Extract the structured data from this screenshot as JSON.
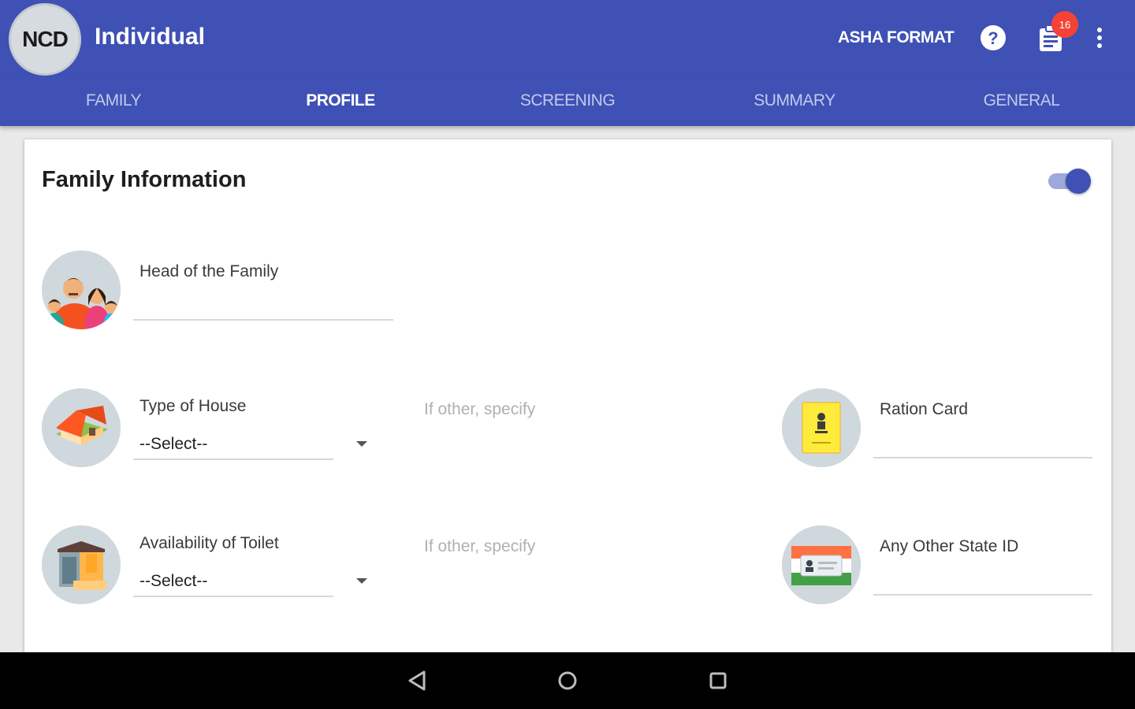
{
  "appbar": {
    "logo_text": "NCD",
    "title": "Individual",
    "action_label": "ASHA FORMAT",
    "notification_count": "16",
    "color": "#3f51b5"
  },
  "tabs": [
    {
      "label": "FAMILY",
      "active": false
    },
    {
      "label": "PROFILE",
      "active": true
    },
    {
      "label": "SCREENING",
      "active": false
    },
    {
      "label": "SUMMARY",
      "active": false
    },
    {
      "label": "GENERAL",
      "active": false
    }
  ],
  "card": {
    "title": "Family Information",
    "toggle_on": true
  },
  "form": {
    "head_of_family": {
      "label": "Head of the Family",
      "value": "",
      "icon": "family-icon"
    },
    "type_of_house": {
      "label": "Type of House",
      "value": "--Select--",
      "icon": "house-icon"
    },
    "house_other": {
      "placeholder": "If other, specify",
      "value": ""
    },
    "ration_card": {
      "label": "Ration Card",
      "value": "",
      "icon": "ration-card-icon"
    },
    "toilet": {
      "label": "Availability of Toilet",
      "value": "--Select--",
      "icon": "toilet-icon"
    },
    "toilet_other": {
      "placeholder": "If other, specify",
      "value": ""
    },
    "state_id": {
      "label": "Any Other State ID",
      "value": "",
      "icon": "state-id-icon"
    }
  },
  "navbar": {
    "icons": [
      "back-icon",
      "home-icon",
      "recents-icon"
    ]
  }
}
